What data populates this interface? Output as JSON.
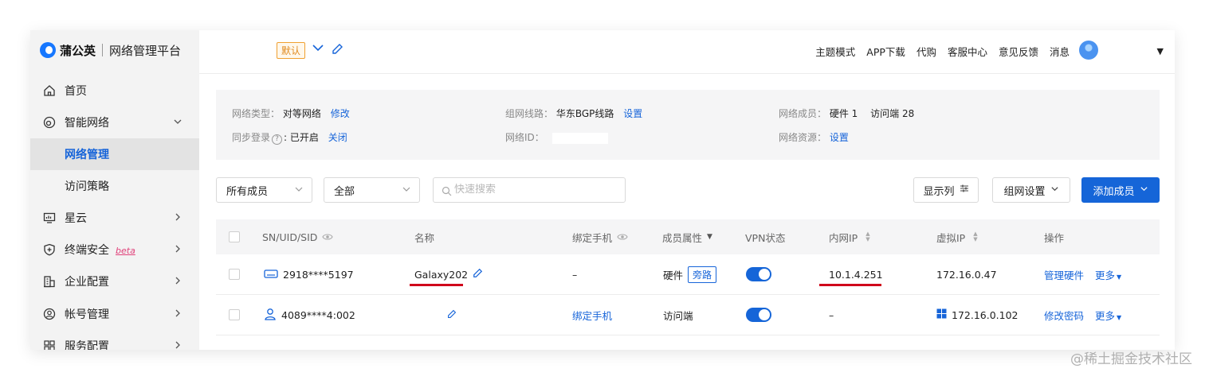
{
  "brand": {
    "name": "蒲公英",
    "subtitle": "网络管理平台"
  },
  "sidebar": {
    "items": [
      {
        "label": "首页",
        "icon": "home-icon"
      },
      {
        "label": "智能网络",
        "icon": "network-icon",
        "expanded": true
      },
      {
        "label": "网络管理",
        "active": true
      },
      {
        "label": "访问策略"
      },
      {
        "label": "星云",
        "icon": "monitor-icon"
      },
      {
        "label": "终端安全",
        "icon": "shield-icon",
        "badge": "beta"
      },
      {
        "label": "企业配置",
        "icon": "building-icon"
      },
      {
        "label": "帐号管理",
        "icon": "user-circle-icon"
      },
      {
        "label": "服务配置",
        "icon": "grid-icon"
      }
    ]
  },
  "header": {
    "network_tag": "默认",
    "links": [
      "主题模式",
      "APP下载",
      "代购",
      "客服中心",
      "意见反馈",
      "消息"
    ]
  },
  "info": {
    "network_type_label": "网络类型：",
    "network_type_value": "对等网络",
    "network_type_action": "修改",
    "sync_login_label": "同步登录",
    "sync_login_value": "已开启",
    "sync_login_action": "关闭",
    "line_label": "组网线路：",
    "line_value": "华东BGP线路",
    "line_action": "设置",
    "network_id_label": "网络ID：",
    "members_label": "网络成员：",
    "members_hardware": "硬件 1",
    "members_clients": "访问端 28",
    "resources_label": "网络资源：",
    "resources_action": "设置"
  },
  "filters": {
    "member_select": "所有成员",
    "scope_select": "全部",
    "search_placeholder": "快速搜索",
    "display_columns": "显示列",
    "network_settings": "组网设置",
    "add_member": "添加成员"
  },
  "table": {
    "columns": [
      "SN/UID/SID",
      "名称",
      "绑定手机",
      "成员属性",
      "VPN状态",
      "内网IP",
      "虚拟IP",
      "操作"
    ],
    "rows": [
      {
        "id": "2918****5197",
        "name": "Galaxy202",
        "phone": "–",
        "type": "硬件",
        "type_tag": "旁路",
        "vpn": true,
        "lan_ip": "10.1.4.251",
        "virtual_ip": "172.16.0.47",
        "action": "管理硬件",
        "more": "更多"
      },
      {
        "id": "4089****4:002",
        "name": "",
        "phone": "绑定手机",
        "type": "访问端",
        "type_tag": "",
        "vpn": true,
        "lan_ip": "–",
        "virtual_ip": "172.16.0.102",
        "action": "修改密码",
        "more": "更多"
      }
    ]
  },
  "watermark": "@稀土掘金技术社区",
  "colors": {
    "accent": "#1565d8",
    "highlight": "#d0021b",
    "tag_orange": "#e08a1e"
  }
}
